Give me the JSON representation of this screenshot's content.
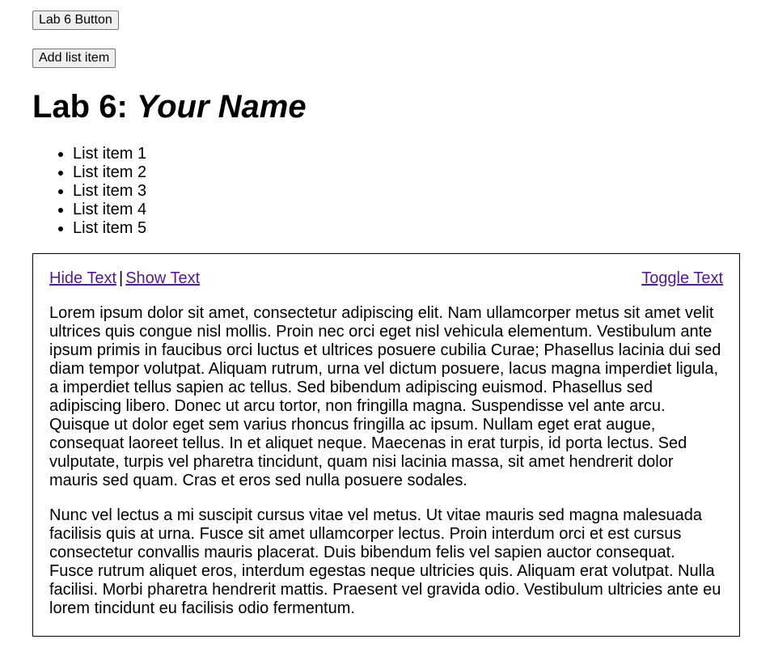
{
  "buttons": {
    "lab_button": "Lab 6 Button",
    "add_list_item": "Add list item"
  },
  "heading": {
    "prefix": "Lab 6:",
    "name": "Your Name"
  },
  "list": [
    "List item 1",
    "List item 2",
    "List item 3",
    "List item 4",
    "List item 5"
  ],
  "box": {
    "hide_text": "Hide Text",
    "separator": "|",
    "show_text": "Show Text",
    "toggle_text": "Toggle Text",
    "paragraphs": [
      "Lorem ipsum dolor sit amet, consectetur adipiscing elit. Nam ullamcorper metus sit amet velit ultrices quis congue nisl mollis. Proin nec orci eget nisl vehicula elementum. Vestibulum ante ipsum primis in faucibus orci luctus et ultrices posuere cubilia Curae; Phasellus lacinia dui sed diam tempor volutpat. Aliquam rutrum, urna vel dictum posuere, lacus magna imperdiet ligula, a imperdiet tellus sapien ac tellus. Sed bibendum adipiscing euismod. Phasellus sed adipiscing libero. Donec ut arcu tortor, non fringilla magna. Suspendisse vel ante arcu. Quisque ut dolor eget sem varius rhoncus fringilla ac ipsum. Nullam eget erat augue, consequat laoreet tellus. In et aliquet neque. Maecenas in erat turpis, id porta lectus. Sed vulputate, turpis vel pharetra tincidunt, quam nisi lacinia massa, sit amet hendrerit dolor mauris sed quam. Cras et eros sed nulla posuere sodales.",
      "Nunc vel lectus a mi suscipit cursus vitae vel metus. Ut vitae mauris sed magna malesuada facilisis quis at urna. Fusce sit amet ullamcorper lectus. Proin interdum orci et est cursus consectetur convallis mauris placerat. Duis bibendum felis vel sapien auctor consequat. Fusce rutrum aliquet eros, interdum egestas neque ultricies quis. Aliquam erat volutpat. Nulla facilisi. Morbi pharetra hendrerit mattis. Praesent vel gravida odio. Vestibulum ultricies ante eu lorem tincidunt eu facilisis odio fermentum."
    ]
  },
  "colors": {
    "visited_link": "#551a8b",
    "button_bg": "#efefef",
    "button_border": "#767676"
  }
}
